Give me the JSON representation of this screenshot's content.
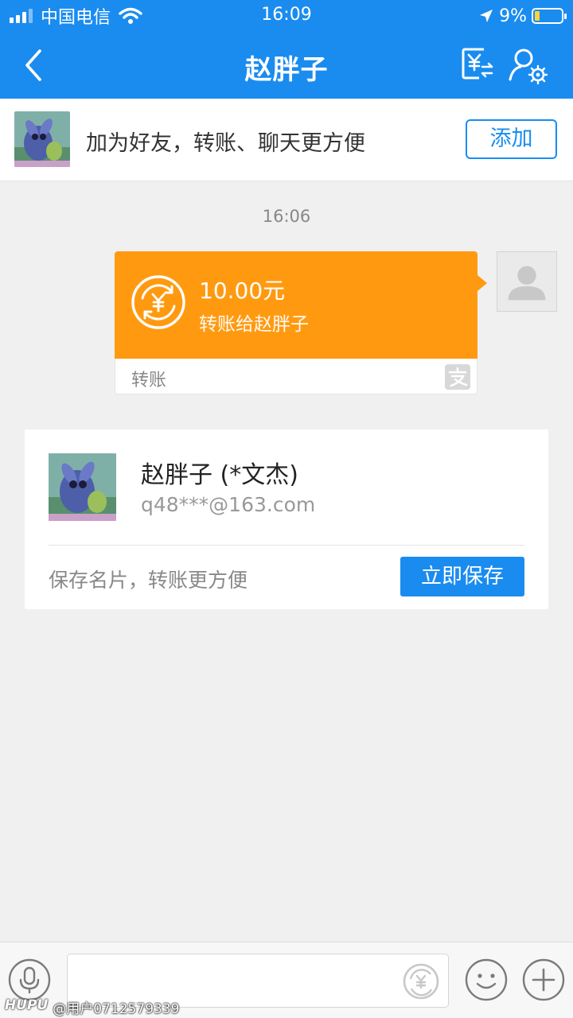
{
  "status_bar": {
    "carrier": "中国电信",
    "time": "16:09",
    "battery": "9%"
  },
  "nav": {
    "title": "赵胖子"
  },
  "friend_banner": {
    "text": "加为好友，转账、聊天更方便",
    "add_button": "添加"
  },
  "chat": {
    "timestamp": "16:06",
    "transfer": {
      "amount": "10.00元",
      "description": "转账给赵胖子",
      "type_label": "转账"
    }
  },
  "contact_card": {
    "name": "赵胖子 (*文杰)",
    "email": "q48***@163.com",
    "hint": "保存名片，转账更方便",
    "save_button": "立即保存"
  },
  "watermark": {
    "brand": "HUPU",
    "user": "@用户0712579339"
  },
  "colors": {
    "primary": "#1a8cf0",
    "transfer_orange": "#ff9a10",
    "background": "#f0f0f0"
  }
}
